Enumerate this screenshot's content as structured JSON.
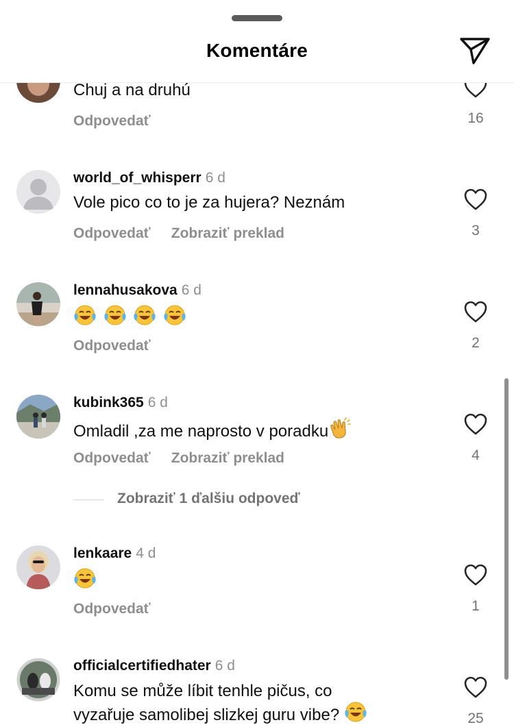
{
  "header": {
    "title": "Komentáre",
    "share_icon": "paper-plane-icon"
  },
  "reply_label": "Odpovedať",
  "translate_label": "Zobraziť preklad",
  "comments": [
    {
      "username": "",
      "time": "",
      "text": "Chuj a na druhú",
      "likes": "16"
    },
    {
      "username": "world_of_whisperr",
      "time": "6 d",
      "text": "Vole pico co to je za hujera? Neznám",
      "likes": "3"
    },
    {
      "username": "lennahusakova",
      "time": "6 d",
      "text": "",
      "emojis": [
        "face-with-tears-of-joy",
        "face-with-tears-of-joy",
        "face-with-tears-of-joy",
        "face-with-tears-of-joy"
      ],
      "likes": "2"
    },
    {
      "username": "kubink365",
      "time": "6 d",
      "text": "Omladil ,za me naprosto v poradku",
      "emojis": [
        "clapping-hands"
      ],
      "likes": "4",
      "more_replies": "Zobraziť 1 ďalšiu odpoveď"
    },
    {
      "username": "lenkaare",
      "time": "4 d",
      "text": "",
      "emojis": [
        "face-with-tears-of-joy"
      ],
      "likes": "1"
    },
    {
      "username": "officialcertifiedhater",
      "time": "6 d",
      "text_line1": "Komu se může líbit tenhle pičus, co",
      "text_line2": "vyzařuje samolibej slizkej guru vibe?",
      "emojis": [
        "face-with-tears-of-joy"
      ],
      "likes": "25"
    }
  ]
}
